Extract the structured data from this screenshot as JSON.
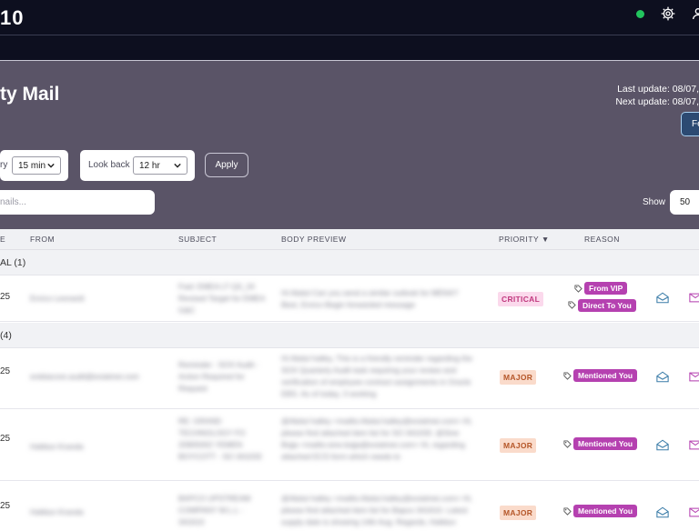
{
  "app": {
    "logo": "10"
  },
  "header": {
    "title": "ty Mail",
    "last_update": "Last update: 08/07,",
    "next_update": "Next update: 08/07,",
    "fe_button": "Fe"
  },
  "filters": {
    "every_label": "ry",
    "every_value": "15 min",
    "lookback_label": "Look back",
    "lookback_value": "12 hr",
    "apply_label": "Apply",
    "search_placeholder": "nails...",
    "show_label": "Show",
    "show_value": "50"
  },
  "table": {
    "headers": {
      "date": "E",
      "from": "FROM",
      "subject": "SUBJECT",
      "body": "BODY PREVIEW",
      "priority": "PRIORITY ▼",
      "reason": "REASON"
    },
    "groups": [
      {
        "label": "AL (1)"
      },
      {
        "label": "(4)"
      }
    ],
    "rows": [
      {
        "date": "25",
        "from": "Enrico Leonardi",
        "subject": "Fwd: EMEA LT Q3_24 Revised Target for EMEA G&C",
        "body": "Hi Abdul Can you send a similar outlook for MENA? Best, Enrico Begin forwarded message",
        "priority": "CRITICAL",
        "reasons": [
          "From VIP",
          "Direct To You"
        ]
      },
      {
        "date": "25",
        "from": "erebiacore.audit@eviatmei.com",
        "subject": "Reminder : SOX Audit - Action Required for Request",
        "body": "Hi Abdul halley, This is a friendly reminder regarding the SOX Quarterly Audit task requiring your review and verification of employee contract assignments in Oracle EBS. As of today, 3 working",
        "priority": "MAJOR",
        "reasons": [
          "Mentioned You"
        ]
      },
      {
        "date": "25",
        "from": "Halldun Kranda",
        "subject": "RE: GRAND TECHNOLOGY FO 20905002 YEMEN BOYCOTT - SO 341033",
        "body": "@Abdul halley <mailto:Abdul.halley@eviatmei.com> Hi, please find attached item list for SO 341033. @Sine Bojja <mailto:sine.bojja@eviatmei.com> Hi, regarding attached ECS form which needs to",
        "priority": "MAJOR",
        "reasons": [
          "Mentioned You"
        ]
      },
      {
        "date": "25",
        "from": "Halldun Kranda",
        "subject": "BAPCO UPSTREAM COMPANY W.L.L - 341610",
        "body": "@Abdul halley <mailto:Abdul.halley@eviatmei.com> Hi, please find attached item list for Bapco 341610. Latest supply date is showing 14th Aug. Regards, Halldun KRANDA Cus",
        "priority": "MAJOR",
        "reasons": [
          "Mentioned You"
        ]
      }
    ]
  },
  "colors": {
    "topbar": "#0d0f1f",
    "hero": "#5a5467",
    "tag": "#b541b0",
    "critical_bg": "#fbd9ec",
    "major_bg": "#fadbcb",
    "status": "#22c55e"
  },
  "icons": [
    "gear-icon",
    "user-icon",
    "chevron-down-icon",
    "tag-icon",
    "envelope-open-icon",
    "envelope-icon"
  ]
}
